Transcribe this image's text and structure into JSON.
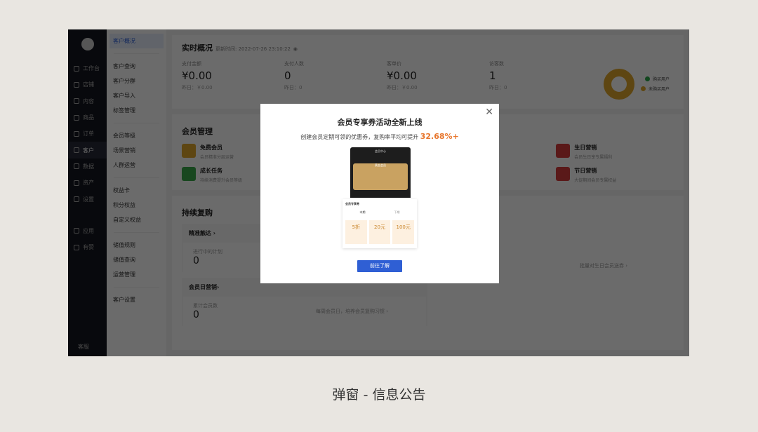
{
  "sidebar": {
    "items": [
      {
        "label": "工作台"
      },
      {
        "label": "店铺"
      },
      {
        "label": "内容"
      },
      {
        "label": "商品"
      },
      {
        "label": "订单"
      },
      {
        "label": "客户",
        "active": true
      },
      {
        "label": "数据"
      },
      {
        "label": "资产"
      },
      {
        "label": "设置"
      },
      {
        "label": "应用"
      },
      {
        "label": "有赞"
      }
    ],
    "service": "客服"
  },
  "subnav": {
    "active": "客户概况",
    "groups": [
      [
        "客户查询",
        "客户分群",
        "客户导入",
        "标签管理"
      ],
      [
        "会员等级",
        "场景营销",
        "人群运营"
      ],
      [
        "权益卡",
        "积分权益",
        "自定义权益"
      ],
      [
        "储值规则",
        "储值查询",
        "运营管理"
      ],
      [
        "客户设置"
      ]
    ]
  },
  "realtime": {
    "title": "实时概况",
    "updated": "更新时间: 2022-07-26 23:10:22",
    "stats": [
      {
        "label": "支付金额",
        "value": "¥0.00",
        "yesterday": "昨日：￥0.00"
      },
      {
        "label": "支付人数",
        "value": "0",
        "yesterday": "昨日：0"
      },
      {
        "label": "客单价",
        "value": "¥0.00",
        "yesterday": "昨日：￥0.00"
      },
      {
        "label": "访客数",
        "value": "1",
        "yesterday": "昨日：0"
      }
    ],
    "legend": [
      {
        "label": "购买用户",
        "color": "#2aa84a"
      },
      {
        "label": "未购买用户",
        "color": "#e0a62a"
      }
    ]
  },
  "member": {
    "title": "会员管理",
    "items": [
      {
        "title": "免费会员",
        "desc": "会员精准分层运营",
        "color": "#e0a62a"
      },
      {
        "title": "",
        "desc": "",
        "color": "#fff"
      },
      {
        "title": "",
        "desc": "",
        "color": "#fff"
      },
      {
        "title": "生日营销",
        "desc": "会员生日享专属福利",
        "color": "#d63b3b"
      },
      {
        "title": "成长任务",
        "desc": "持续消费提升会员等级",
        "color": "#3aa84a"
      },
      {
        "title": "",
        "desc": "",
        "color": "#fff"
      },
      {
        "title": "",
        "desc": "",
        "color": "#fff"
      },
      {
        "title": "节日营销",
        "desc": "大促期间会员专属权益",
        "color": "#d63b3b"
      }
    ]
  },
  "repurchase": {
    "title": "持续复购",
    "blocks": [
      {
        "title": "精准触达 ›",
        "stat_label": "进行中的计划",
        "stat": "0",
        "link": ""
      },
      {
        "title": "会员日营销›",
        "stat_label": "累计会员数",
        "stat": "0",
        "link": "每周会员日，培养会员复购习惯 ›"
      }
    ],
    "birthday_link": "批量对生日会员送券 ›"
  },
  "modal": {
    "title": "会员专享券活动全新上线",
    "subtitle": "创建会员定期可领的优惠券，复购率平均可提升",
    "highlight": "32.68%+",
    "button": "前往了解",
    "phone": {
      "header": "会员中心",
      "gold": "黄金会员",
      "coupon_title": "会员专享券",
      "tab1": "本期",
      "tab2": "下期",
      "coupons": [
        "5折",
        "20元",
        "100元"
      ]
    }
  },
  "caption": "弹窗 - 信息公告"
}
